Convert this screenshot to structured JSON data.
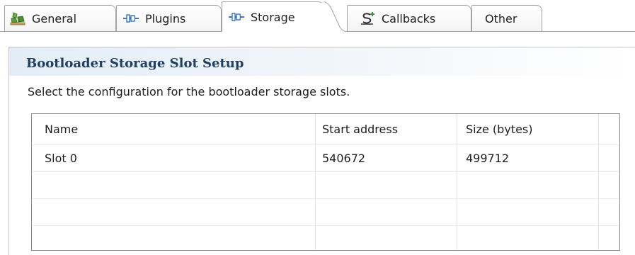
{
  "tabs": [
    {
      "label": "General",
      "icon": "general-icon"
    },
    {
      "label": "Plugins",
      "icon": "plugin-icon"
    },
    {
      "label": "Storage",
      "icon": "plugin-icon"
    },
    {
      "label": "Callbacks",
      "icon": "callbacks-icon"
    },
    {
      "label": "Other"
    }
  ],
  "active_tab": "Storage",
  "section": {
    "title": "Bootloader Storage Slot Setup",
    "description": "Select the configuration for the bootloader storage slots."
  },
  "table": {
    "columns": [
      "Name",
      "Start address",
      "Size (bytes)"
    ],
    "rows": [
      [
        "Slot 0",
        "540672",
        "499712"
      ],
      [
        "",
        "",
        ""
      ],
      [
        "",
        "",
        ""
      ],
      [
        "",
        "",
        ""
      ]
    ]
  },
  "colors": {
    "section_title": "#1f3f63",
    "header_gradient_start": "#e4edf6",
    "plugin_icon_blue": "#3a78c2",
    "callbacks_icon_green": "#2f9a3a",
    "general_icon_green": "#4a9a3a"
  }
}
